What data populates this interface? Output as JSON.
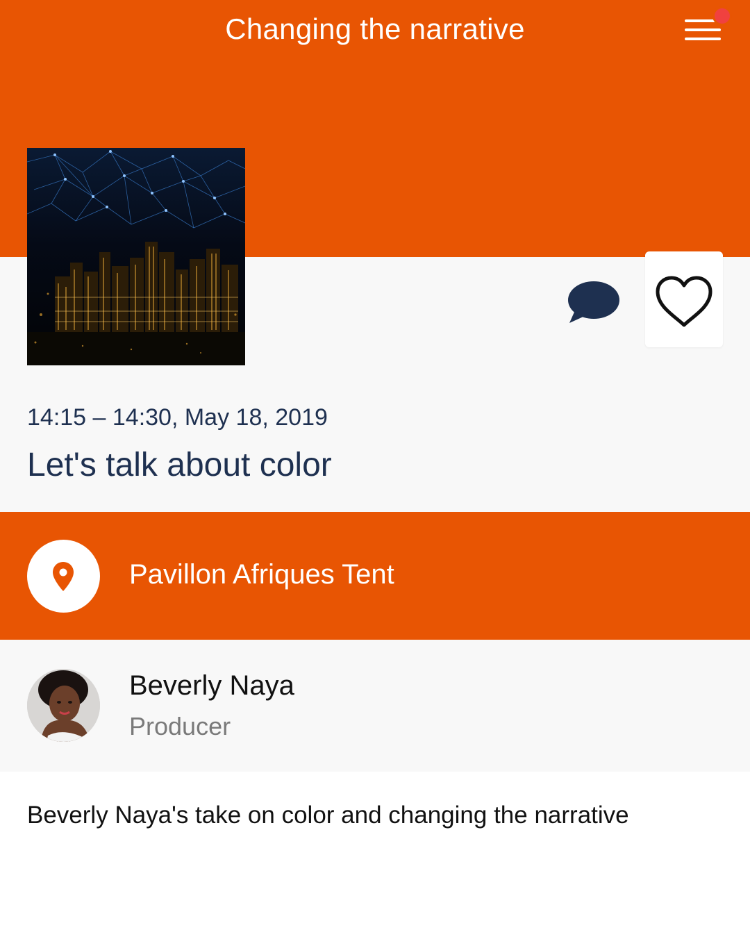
{
  "header": {
    "title": "Changing the narrative",
    "menu_icon": "hamburger-menu-icon",
    "notification_color": "#F0413F"
  },
  "colors": {
    "brand": "#E85503",
    "text_dark": "#1E3050",
    "panel_bg": "#F8F8F8"
  },
  "session": {
    "time": "14:15 – 14:30, May 18, 2019",
    "title": "Let's talk about color",
    "image": "night-city-skyline-network-image"
  },
  "actions": {
    "comment_icon": "speech-bubble-icon",
    "favorite_icon": "heart-outline-icon"
  },
  "location": {
    "icon": "map-pin-icon",
    "name": "Pavillon Afriques Tent"
  },
  "speaker": {
    "name": "Beverly Naya",
    "role": "Producer",
    "avatar": "speaker-photo-avatar"
  },
  "description": "Beverly Naya's take on color and changing the narrative"
}
